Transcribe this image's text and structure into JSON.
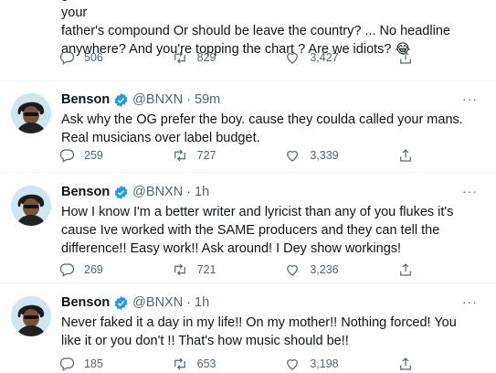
{
  "partial_tweet": {
    "text": "game , not Balmoral , not Eko hotel , not Muri Okunola , no even your\nfather's compound Or should be leave the country? ... No headline\nanywhere? And you're topping the chart ? Are we idiots? 😂",
    "replies": "506",
    "retweets": "829",
    "likes": "3,427"
  },
  "tweets": [
    {
      "name": "Benson",
      "handle": "@BNXN",
      "separator": "·",
      "time": "59m",
      "more": "···",
      "text": "Ask why the OG prefer the boy. cause they coulda called your mans. Real musicians over label budget.",
      "replies": "259",
      "retweets": "727",
      "likes": "3,339"
    },
    {
      "name": "Benson",
      "handle": "@BNXN",
      "separator": "·",
      "time": "1h",
      "more": "···",
      "text": "How I know I'm a better writer and lyricist than any of you flukes it's cause Ive worked with the SAME producers and they can tell the difference!! Easy work!! Ask around! I Dey show workings!",
      "replies": "269",
      "retweets": "721",
      "likes": "3,236"
    },
    {
      "name": "Benson",
      "handle": "@BNXN",
      "separator": "·",
      "time": "1h",
      "more": "···",
      "text": "Never faked it a day in my life!! On my mother!! Nothing forced! You like it or you don't !! That's how music should be!!",
      "replies": "185",
      "retweets": "653",
      "likes": "3,198"
    }
  ],
  "colors": {
    "verified": "#1d9bf0",
    "secondary_text": "#536471",
    "divider": "#eff3f4"
  },
  "icons": [
    "reply-icon",
    "retweet-icon",
    "like-icon",
    "share-icon",
    "verified-badge-icon",
    "more-icon"
  ]
}
